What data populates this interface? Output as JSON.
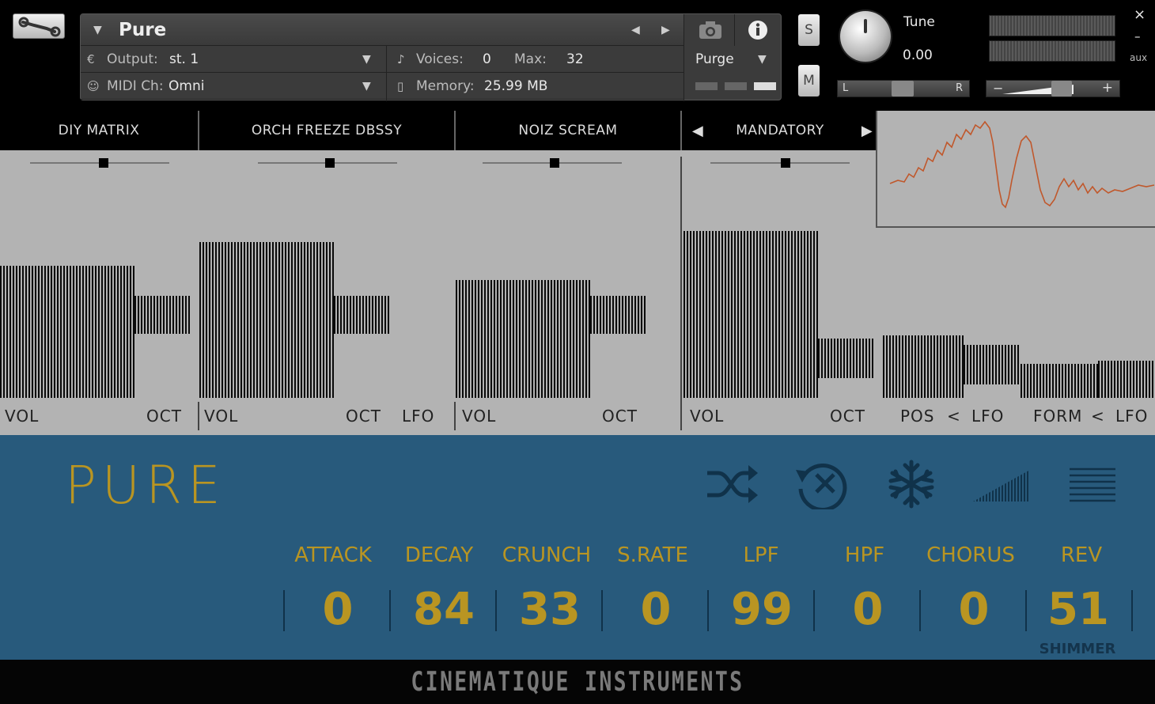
{
  "header": {
    "instrument_name": "Pure",
    "output_label": "Output:",
    "output_value": "st. 1",
    "midi_label": "MIDI Ch:",
    "midi_value": "Omni",
    "voices_label": "Voices:",
    "voices_value": "0",
    "max_label": "Max:",
    "max_value": "32",
    "memory_label": "Memory:",
    "memory_value": "25.99 MB",
    "purge_label": "Purge",
    "solo_label": "S",
    "mute_label": "M",
    "tune_label": "Tune",
    "tune_value": "0.00",
    "pan_left": "L",
    "pan_right": "R",
    "vol_minus": "−",
    "vol_plus": "+",
    "aux_label": "aux",
    "close_label": "×",
    "minimize_label": "–"
  },
  "tabs": [
    {
      "label": "DIY MATRIX"
    },
    {
      "label": "ORCH FREEZE DBSSY"
    },
    {
      "label": "NOIZ SCREAM"
    },
    {
      "label": "MANDATORY"
    }
  ],
  "matrix": {
    "labels": [
      "VOL",
      "OCT",
      "VOL",
      "OCT",
      "LFO",
      "VOL",
      "OCT",
      "VOL",
      "OCT",
      "POS",
      "<",
      "LFO",
      "FORM",
      "<",
      "LFO"
    ]
  },
  "main": {
    "title": "PURE",
    "params": [
      {
        "label": "ATTACK",
        "value": "0"
      },
      {
        "label": "DECAY",
        "value": "84"
      },
      {
        "label": "CRUNCH",
        "value": "33"
      },
      {
        "label": "S.RATE",
        "value": "0"
      },
      {
        "label": "LPF",
        "value": "99"
      },
      {
        "label": "HPF",
        "value": "0"
      },
      {
        "label": "CHORUS",
        "value": "0"
      },
      {
        "label": "REV",
        "value": "51"
      }
    ],
    "rev_mode": "SHIMMER",
    "icons": [
      "shuffle-icon",
      "reset-icon",
      "freeze-icon",
      "velocity-ramp-icon",
      "lines-icon"
    ]
  },
  "footer": {
    "brand": "CINEMATIQUE INSTRUMENTS"
  },
  "colors": {
    "accent": "#b99522",
    "panel": "#285a7c",
    "matrix_bg": "#b3b3b3",
    "wave": "#c0582c"
  }
}
